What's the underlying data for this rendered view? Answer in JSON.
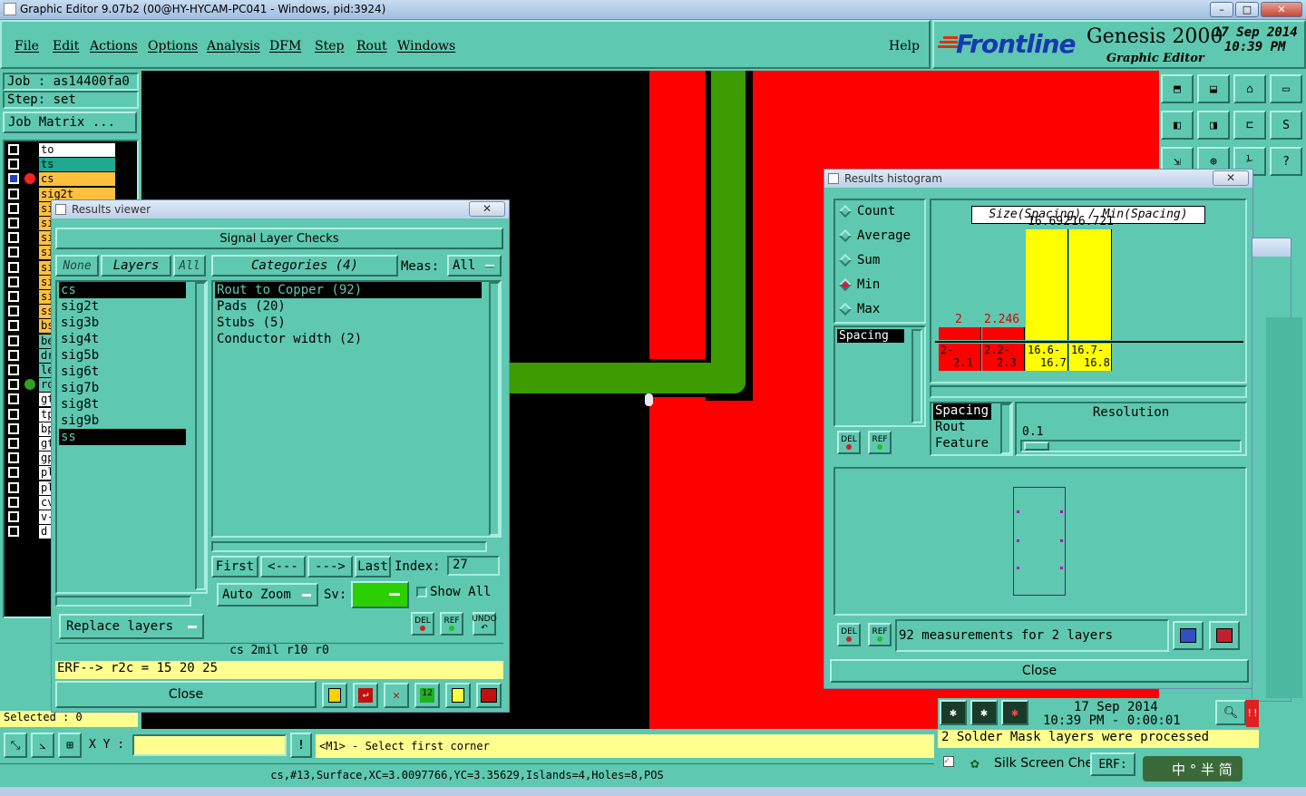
{
  "window": {
    "title": "Graphic Editor 9.07b2 (00@HY-HYCAM-PC041 - Windows, pid:3924)"
  },
  "menu": [
    "File",
    "Edit",
    "Actions",
    "Options",
    "Analysis",
    "DFM",
    "Step",
    "Rout",
    "Windows"
  ],
  "help_label": "Help",
  "logo": {
    "brand": "Frontline",
    "product": "Genesis 2000",
    "subtitle": "Graphic Editor",
    "date": "17 Sep 2014",
    "time": "10:39 PM"
  },
  "job": {
    "job_label": "Job : as14400fa0",
    "step_label": "Step: set",
    "matrix_button": "Job Matrix ..."
  },
  "layer_rows": [
    "to",
    "ts",
    "cs",
    "sig2t",
    "si",
    "si",
    "si",
    "si",
    "si",
    "si",
    "si",
    "ss",
    "bs",
    "be",
    "dr",
    "le",
    "ro",
    "gt",
    "tp",
    "bp",
    "gt",
    "gp",
    "pl",
    "pl",
    "cv",
    "v-",
    "d"
  ],
  "selected_label": "Selected : 0",
  "results_viewer": {
    "title": "Results viewer",
    "header": "Signal Layer Checks",
    "none_btn": "None",
    "layers_btn": "Layers",
    "all_btn": "All",
    "categories_btn": "Categories (4)",
    "meas_label": "Meas:",
    "meas_value": "All",
    "layers": [
      "cs",
      "sig2t",
      "sig3b",
      "sig4t",
      "sig5b",
      "sig6t",
      "sig7b",
      "sig8t",
      "sig9b",
      "ss"
    ],
    "categories": [
      "Rout to Copper (92)",
      "Pads (20)",
      "Stubs (5)",
      "Conductor width (2)"
    ],
    "first_btn": "First",
    "prev_btn": "<---",
    "next_btn": "--->",
    "last_btn": "Last",
    "index_label": "Index:",
    "index_value": "27",
    "auto_zoom": "Auto Zoom",
    "sv_label": "Sv:",
    "show_all": "Show All",
    "replace_layers": "Replace layers",
    "del": "DEL",
    "ref": "REF",
    "undo": "UNDO",
    "info_line": "cs 2mil  r10  r0",
    "erf_line": "ERF--> r2c = 15 20 25",
    "close": "Close"
  },
  "histogram": {
    "title": "Results histogram",
    "modes": [
      "Count",
      "Average",
      "Sum",
      "Min",
      "Max"
    ],
    "selected_mode": "Min",
    "list_item": "Spacing",
    "chart_title": "Size(Spacing) / Min(Spacing)",
    "bins": [
      {
        "label_top": "2-",
        "label_bottom": "2.1",
        "value_label": "2",
        "color": "#ff0000"
      },
      {
        "label_top": "2.2-",
        "label_bottom": "2.3",
        "value_label": "2.246",
        "color": "#ff0000"
      },
      {
        "label_top": "16.6-",
        "label_bottom": "16.7",
        "value_label": "16.692",
        "color": "#ffff00"
      },
      {
        "label_top": "16.7-",
        "label_bottom": "16.8",
        "value_label": "16.721",
        "color": "#ffff00"
      }
    ],
    "attr_list": [
      "Spacing",
      "Rout",
      "Feature"
    ],
    "resolution_label": "Resolution",
    "resolution_value": "0.1",
    "measurements": "92 measurements for 2 layers",
    "del": "DEL",
    "ref": "REF",
    "close": "Close"
  },
  "status_panel": {
    "date": "17 Sep 2014",
    "time_line": "10:39 PM - 0:00:01",
    "message": "2 Solder Mask layers were processed",
    "silk_label": "Silk Screen Che",
    "erf_label": "ERF:",
    "alert": "!!"
  },
  "bottom_bar": {
    "xy_label": "X Y :",
    "xy_value": "",
    "prompt": "<M1> - Select first corner",
    "status": "cs,#13,Surface,XC=3.0097766,YC=3.35629,Islands=4,Holes=8,POS"
  },
  "tray": {
    "ime": "中 ° 半 简"
  },
  "colors": {
    "panel": "#5ec8b0",
    "canvas": "#000000",
    "copper": "#ff0000",
    "trace": "#3c9c00",
    "yellow": "#ffff00"
  }
}
